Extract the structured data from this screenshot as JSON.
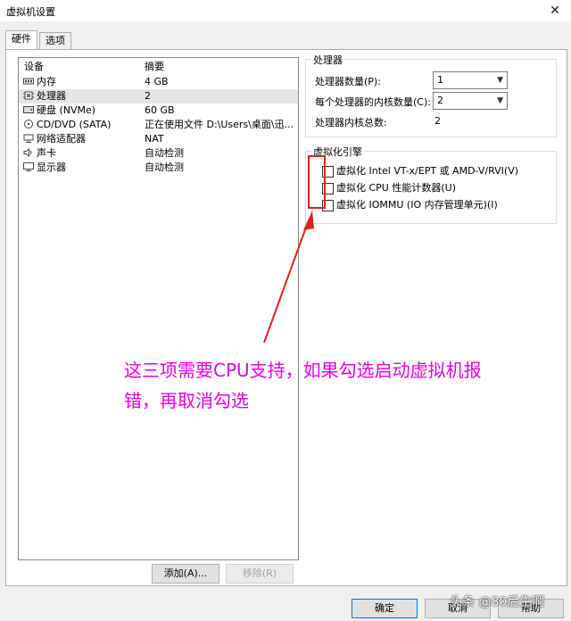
{
  "window": {
    "title": "虚拟机设置"
  },
  "tabs": [
    {
      "label": "硬件"
    },
    {
      "label": "选项"
    }
  ],
  "device_list": {
    "headers": {
      "device": "设备",
      "summary": "摘要"
    },
    "rows": [
      {
        "name": "内存",
        "summary": "4 GB",
        "icon": "memory-icon"
      },
      {
        "name": "处理器",
        "summary": "2",
        "icon": "processor-icon",
        "selected": true
      },
      {
        "name": "硬盘 (NVMe)",
        "summary": "60 GB",
        "icon": "hard-disk-icon"
      },
      {
        "name": "CD/DVD (SATA)",
        "summary": "正在使用文件 D:\\Users\\桌面\\迅...",
        "icon": "cd-dvd-icon"
      },
      {
        "name": "网络适配器",
        "summary": "NAT",
        "icon": "network-adapter-icon"
      },
      {
        "name": "声卡",
        "summary": "自动检测",
        "icon": "sound-card-icon"
      },
      {
        "name": "显示器",
        "summary": "自动检测",
        "icon": "display-icon"
      }
    ]
  },
  "buttons": {
    "add": "添加(A)...",
    "remove": "移除(R)",
    "ok": "确定",
    "cancel": "取消",
    "help": "帮助"
  },
  "processor": {
    "group_label": "处理器",
    "count_label": "处理器数量(P):",
    "count_value": "1",
    "cores_label": "每个处理器的内核数量(C):",
    "cores_value": "2",
    "total_label": "处理器内核总数:",
    "total_value": "2"
  },
  "virtualization": {
    "group_label": "虚拟化引擎",
    "options": [
      {
        "label": "虚拟化 Intel VT-x/EPT 或 AMD-V/RVI(V)",
        "checked": false
      },
      {
        "label": "虚拟化 CPU 性能计数器(U)",
        "checked": false
      },
      {
        "label": "虚拟化 IOMMU (IO 内存管理单元)(I)",
        "checked": false
      }
    ]
  },
  "annotation": {
    "line1": "这三项需要CPU支持，如果勾选启动虚拟机报",
    "line2": "错，再取消勾选",
    "color": "#e600e6",
    "highlight_color": "#e02020"
  },
  "watermark": "头条 @80后生啊"
}
